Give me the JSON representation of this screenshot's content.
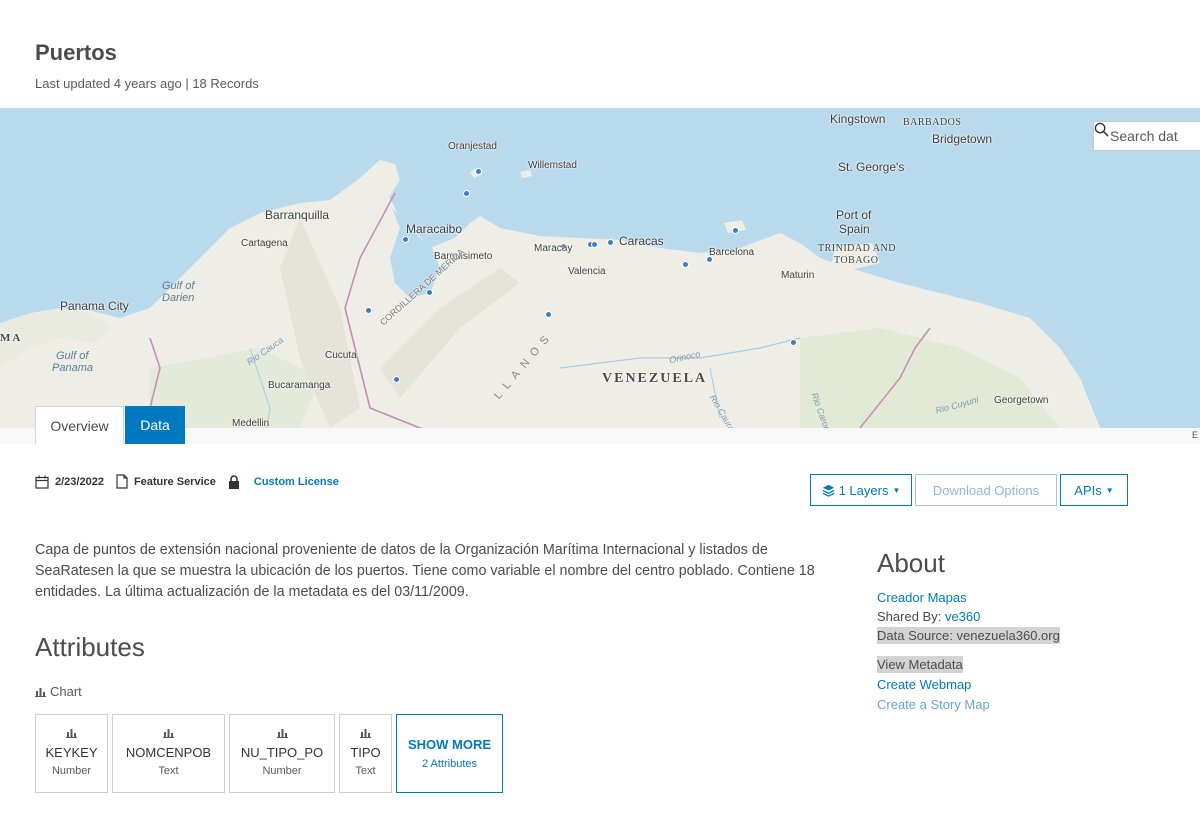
{
  "header": {
    "title": "Puertos",
    "subtitle": "Last updated 4 years ago | 18 Records"
  },
  "map": {
    "search_placeholder": "Search dat",
    "attribution": "E",
    "labels": {
      "kingstown": "Kingstown",
      "barbados": "BARBADOS",
      "bridgetown": "Bridgetown",
      "oranjestad": "Oranjestad",
      "willemstad": "Willemstad",
      "st_georges": "St. George's",
      "barranquilla": "Barranquilla",
      "maracaibo": "Maracaibo",
      "port_of": "Port of",
      "spain": "Spain",
      "cartagena": "Cartagena",
      "barquisimeto": "Barquisimeto",
      "maracay": "Maracay",
      "caracas": "Caracas",
      "barcelona": "Barcelona",
      "trinidad": "TRINIDAD AND",
      "tobago": "TOBAGO",
      "valencia": "Valencia",
      "maturin": "Maturin",
      "gulf_darien_1": "Gulf of",
      "gulf_darien_2": "Darien",
      "panama_city": "Panama City",
      "cordillera": "CORDILLERA DE MERIDA",
      "ma": "MA",
      "llanos": "LLANOS",
      "gulf_panama_1": "Gulf of",
      "gulf_panama_2": "Panama",
      "rio_cauca": "Rio Cauca",
      "cucuta": "Cucuta",
      "orinoco": "Orinoco",
      "venezuela": "VENEZUELA",
      "bucaramanga": "Bucaramanga",
      "rio_caroni": "Rio Caroni",
      "rio_cuyuni": "Rio Cuyuni",
      "georgetown": "Georgetown",
      "medellin": "Medellin",
      "rio_caura": "Rio Caura"
    }
  },
  "tabs": {
    "overview": "Overview",
    "data": "Data"
  },
  "info": {
    "date": "2/23/2022",
    "type": "Feature Service",
    "license": "Custom License"
  },
  "buttons": {
    "layers": "1 Layers",
    "download": "Download Options",
    "apis": "APIs"
  },
  "description": "Capa de puntos de extensión nacional proveniente de datos de la Organización Marítima Internacional y  listados de SeaRatesen la que se muestra la ubicación de los puertos. Tiene como variable el nombre del centro poblado. Contiene 18 entidades. La última actualización de la metadata es del 03/11/2009.",
  "attributes": {
    "title": "Attributes",
    "chart_label": "Chart",
    "cards": [
      {
        "name": "KEYKEY",
        "type": "Number"
      },
      {
        "name": "NOMCENPOB",
        "type": "Text"
      },
      {
        "name": "NU_TIPO_PO",
        "type": "Number"
      },
      {
        "name": "TIPO",
        "type": "Text"
      }
    ],
    "show_more": "SHOW MORE",
    "show_more_count": "2 Attributes"
  },
  "about": {
    "title": "About",
    "owner": "Creador Mapas",
    "shared_by_label": "Shared By: ",
    "shared_by_value": "ve360",
    "data_source": "Data Source: venezuela360.org",
    "view_metadata": "View Metadata",
    "create_webmap": "Create Webmap",
    "create_story_map": "Create a Story Map"
  },
  "colors": {
    "accent": "#0079c1",
    "port_point": "#3b7fc4",
    "water": "#b9d9ec",
    "land": "#eeeee6"
  }
}
